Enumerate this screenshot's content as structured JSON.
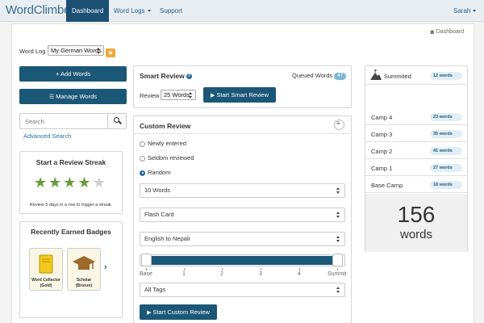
{
  "navbar": {
    "brand": "WordClimber",
    "items": [
      {
        "label": "Dashboard"
      },
      {
        "label": "Word Logs"
      },
      {
        "label": "Support"
      }
    ],
    "user": "Sarah"
  },
  "breadcrumb": "Dashboard",
  "word_log": {
    "label": "Word Log",
    "selected": "My German Words"
  },
  "left": {
    "add_words": "+ Add Words",
    "manage_words": "Manage Words",
    "search_placeholder": "Search",
    "advanced_search": "Advanced Search",
    "streak": {
      "title": "Start a Review Streak",
      "stars_filled": 4,
      "stars_total": 5,
      "note": "Review 5 days in a row to trigger a streak."
    },
    "badges": {
      "title": "Recently Earned Badges",
      "items": [
        {
          "name": "Word Collector",
          "level": "(Gold)"
        },
        {
          "name": "Scholar",
          "level": "(Bronze)"
        }
      ]
    }
  },
  "smart_review": {
    "title": "Smart Review",
    "queued_label": "Queued Words",
    "queued_count": "47",
    "review_label": "Review",
    "review_selected": "25 Words",
    "start_button": "Start Smart Review"
  },
  "custom_review": {
    "title": "Custom Review",
    "options": [
      {
        "label": "Newly entered",
        "checked": false
      },
      {
        "label": "Seldom reviewed",
        "checked": false
      },
      {
        "label": "Random",
        "checked": true
      }
    ],
    "count_select": "10 Words",
    "mode_select": "Flash Card",
    "direction_select": "English to Nepali",
    "slider_labels": [
      "Base",
      "1",
      "2",
      "3",
      "4",
      "Summit"
    ],
    "tags_select": "All Tags",
    "start_button": "Start Custom Review"
  },
  "levels": {
    "rows": [
      {
        "name": "Summited",
        "count": "12 words"
      },
      {
        "name": "Camp 4",
        "count": "23 words"
      },
      {
        "name": "Camp 3",
        "count": "35 words"
      },
      {
        "name": "Camp 2",
        "count": "41 words"
      },
      {
        "name": "Camp 1",
        "count": "27 words"
      },
      {
        "name": "Base Camp",
        "count": "18 words"
      }
    ],
    "total": "156",
    "total_unit": "words"
  }
}
